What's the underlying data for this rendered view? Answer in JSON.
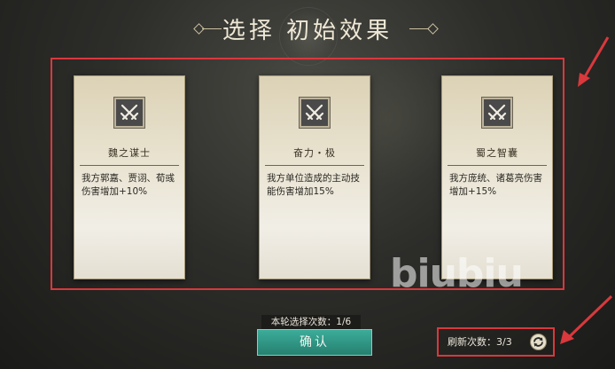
{
  "title": "选择 初始效果",
  "cards": [
    {
      "name": "魏之谋士",
      "desc": "我方郭嘉、贾诩、荀彧伤害增加+10%",
      "icon": "crossed-swords-icon"
    },
    {
      "name": "奋力・极",
      "desc": "我方单位造成的主动技能伤害增加15%",
      "icon": "crossed-swords-icon"
    },
    {
      "name": "蜀之智囊",
      "desc": "我方庞统、诸葛亮伤害增加+15%",
      "icon": "crossed-swords-icon"
    }
  ],
  "selection_count_label": "本轮选择次数：1/6",
  "confirm_label": "确认",
  "refresh_label": "刷新次数：3/3",
  "watermark": "biubiu",
  "colors": {
    "accent_teal": "#2f9b88",
    "highlight_red": "#d9383c",
    "card_paper": "#e8e2cf"
  }
}
